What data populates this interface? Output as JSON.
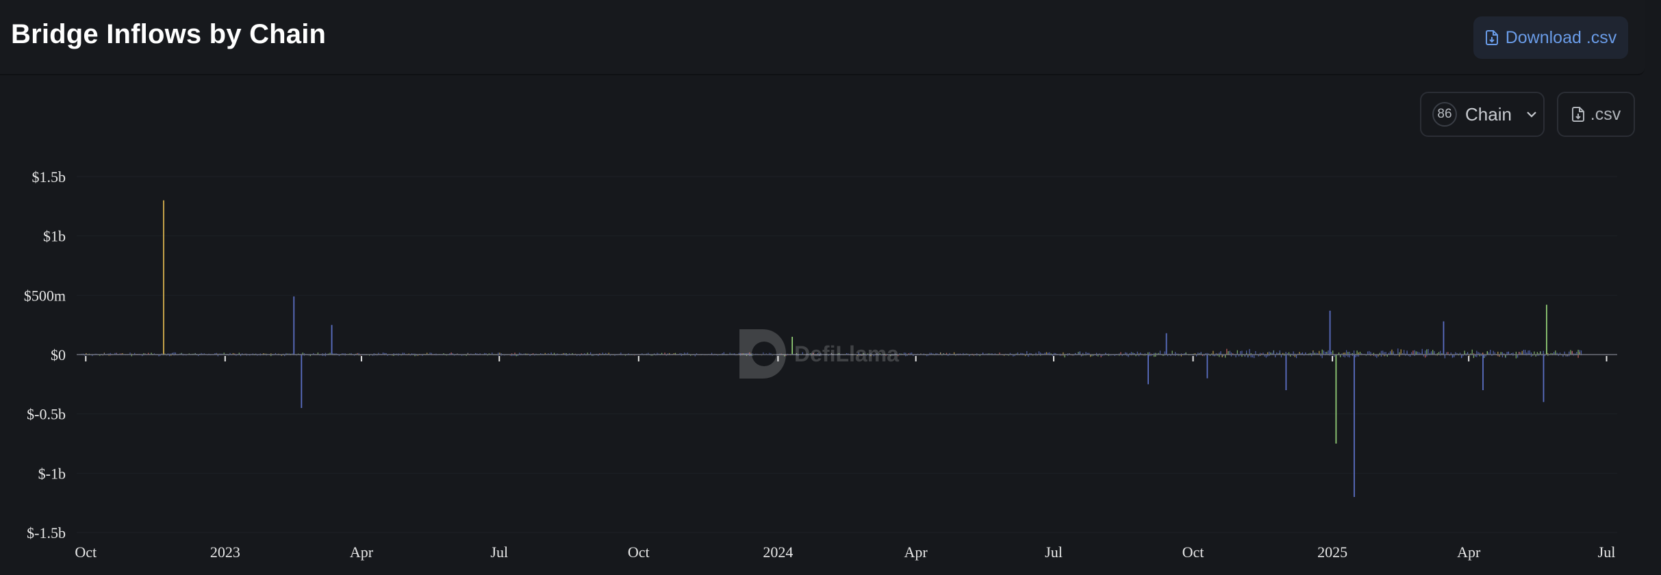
{
  "header": {
    "title": "Bridge Inflows by Chain",
    "download_label": "Download .csv"
  },
  "controls": {
    "chain_count": "86",
    "chain_label": "Chain",
    "csv_label": ".csv"
  },
  "watermark": {
    "text": "DefiLlama"
  },
  "colors": {
    "background": "#16181c",
    "blue": "#5b6fc4",
    "green": "#91cc75",
    "yellow": "#d6b04e",
    "red": "#e06b6b",
    "accent": "#6a9ce8"
  },
  "chart_data": {
    "type": "bar",
    "title": "Bridge Inflows by Chain",
    "ylim": [
      -1500000000,
      1500000000
    ],
    "y_ticks": [
      {
        "value": 1500000000,
        "label": "$1.5b"
      },
      {
        "value": 1000000000,
        "label": "$1b"
      },
      {
        "value": 500000000,
        "label": "$500m"
      },
      {
        "value": 0,
        "label": "$0"
      },
      {
        "value": -500000000,
        "label": "$-0.5b"
      },
      {
        "value": -1000000000,
        "label": "$-1b"
      },
      {
        "value": -1500000000,
        "label": "$-1.5b"
      }
    ],
    "xlim": [
      "2022-09-25",
      "2025-07-08"
    ],
    "x_ticks": [
      {
        "date": "2022-10-01",
        "label": "Oct"
      },
      {
        "date": "2023-01-01",
        "label": "2023"
      },
      {
        "date": "2023-04-01",
        "label": "Apr"
      },
      {
        "date": "2023-07-01",
        "label": "Jul"
      },
      {
        "date": "2023-10-01",
        "label": "Oct"
      },
      {
        "date": "2024-01-01",
        "label": "2024"
      },
      {
        "date": "2024-04-01",
        "label": "Apr"
      },
      {
        "date": "2024-07-01",
        "label": "Jul"
      },
      {
        "date": "2024-10-01",
        "label": "Oct"
      },
      {
        "date": "2025-01-01",
        "label": "2025"
      },
      {
        "date": "2025-04-01",
        "label": "Apr"
      },
      {
        "date": "2025-07-01",
        "label": "Jul"
      }
    ],
    "grid": true,
    "series_colors": [
      "#5b6fc4",
      "#91cc75",
      "#d6b04e",
      "#e06b6b"
    ],
    "notable_bars": [
      {
        "date": "2022-11-21",
        "value": 1300000000,
        "color": "#d6b04e"
      },
      {
        "date": "2023-02-15",
        "value": 490000000,
        "color": "#5b6fc4"
      },
      {
        "date": "2023-02-20",
        "value": -450000000,
        "color": "#5b6fc4"
      },
      {
        "date": "2023-03-12",
        "value": 250000000,
        "color": "#5b6fc4"
      },
      {
        "date": "2024-01-10",
        "value": 150000000,
        "color": "#91cc75"
      },
      {
        "date": "2024-09-01",
        "value": -250000000,
        "color": "#5b6fc4"
      },
      {
        "date": "2024-09-13",
        "value": 180000000,
        "color": "#5b6fc4"
      },
      {
        "date": "2024-10-10",
        "value": -200000000,
        "color": "#5b6fc4"
      },
      {
        "date": "2024-12-01",
        "value": -300000000,
        "color": "#5b6fc4"
      },
      {
        "date": "2024-12-30",
        "value": 370000000,
        "color": "#5b6fc4"
      },
      {
        "date": "2025-01-03",
        "value": -750000000,
        "color": "#91cc75"
      },
      {
        "date": "2025-01-15",
        "value": -1200000000,
        "color": "#5b6fc4"
      },
      {
        "date": "2025-03-15",
        "value": 280000000,
        "color": "#5b6fc4"
      },
      {
        "date": "2025-04-10",
        "value": -300000000,
        "color": "#5b6fc4"
      },
      {
        "date": "2025-05-20",
        "value": -400000000,
        "color": "#5b6fc4"
      },
      {
        "date": "2025-05-22",
        "value": 420000000,
        "color": "#91cc75"
      }
    ]
  }
}
